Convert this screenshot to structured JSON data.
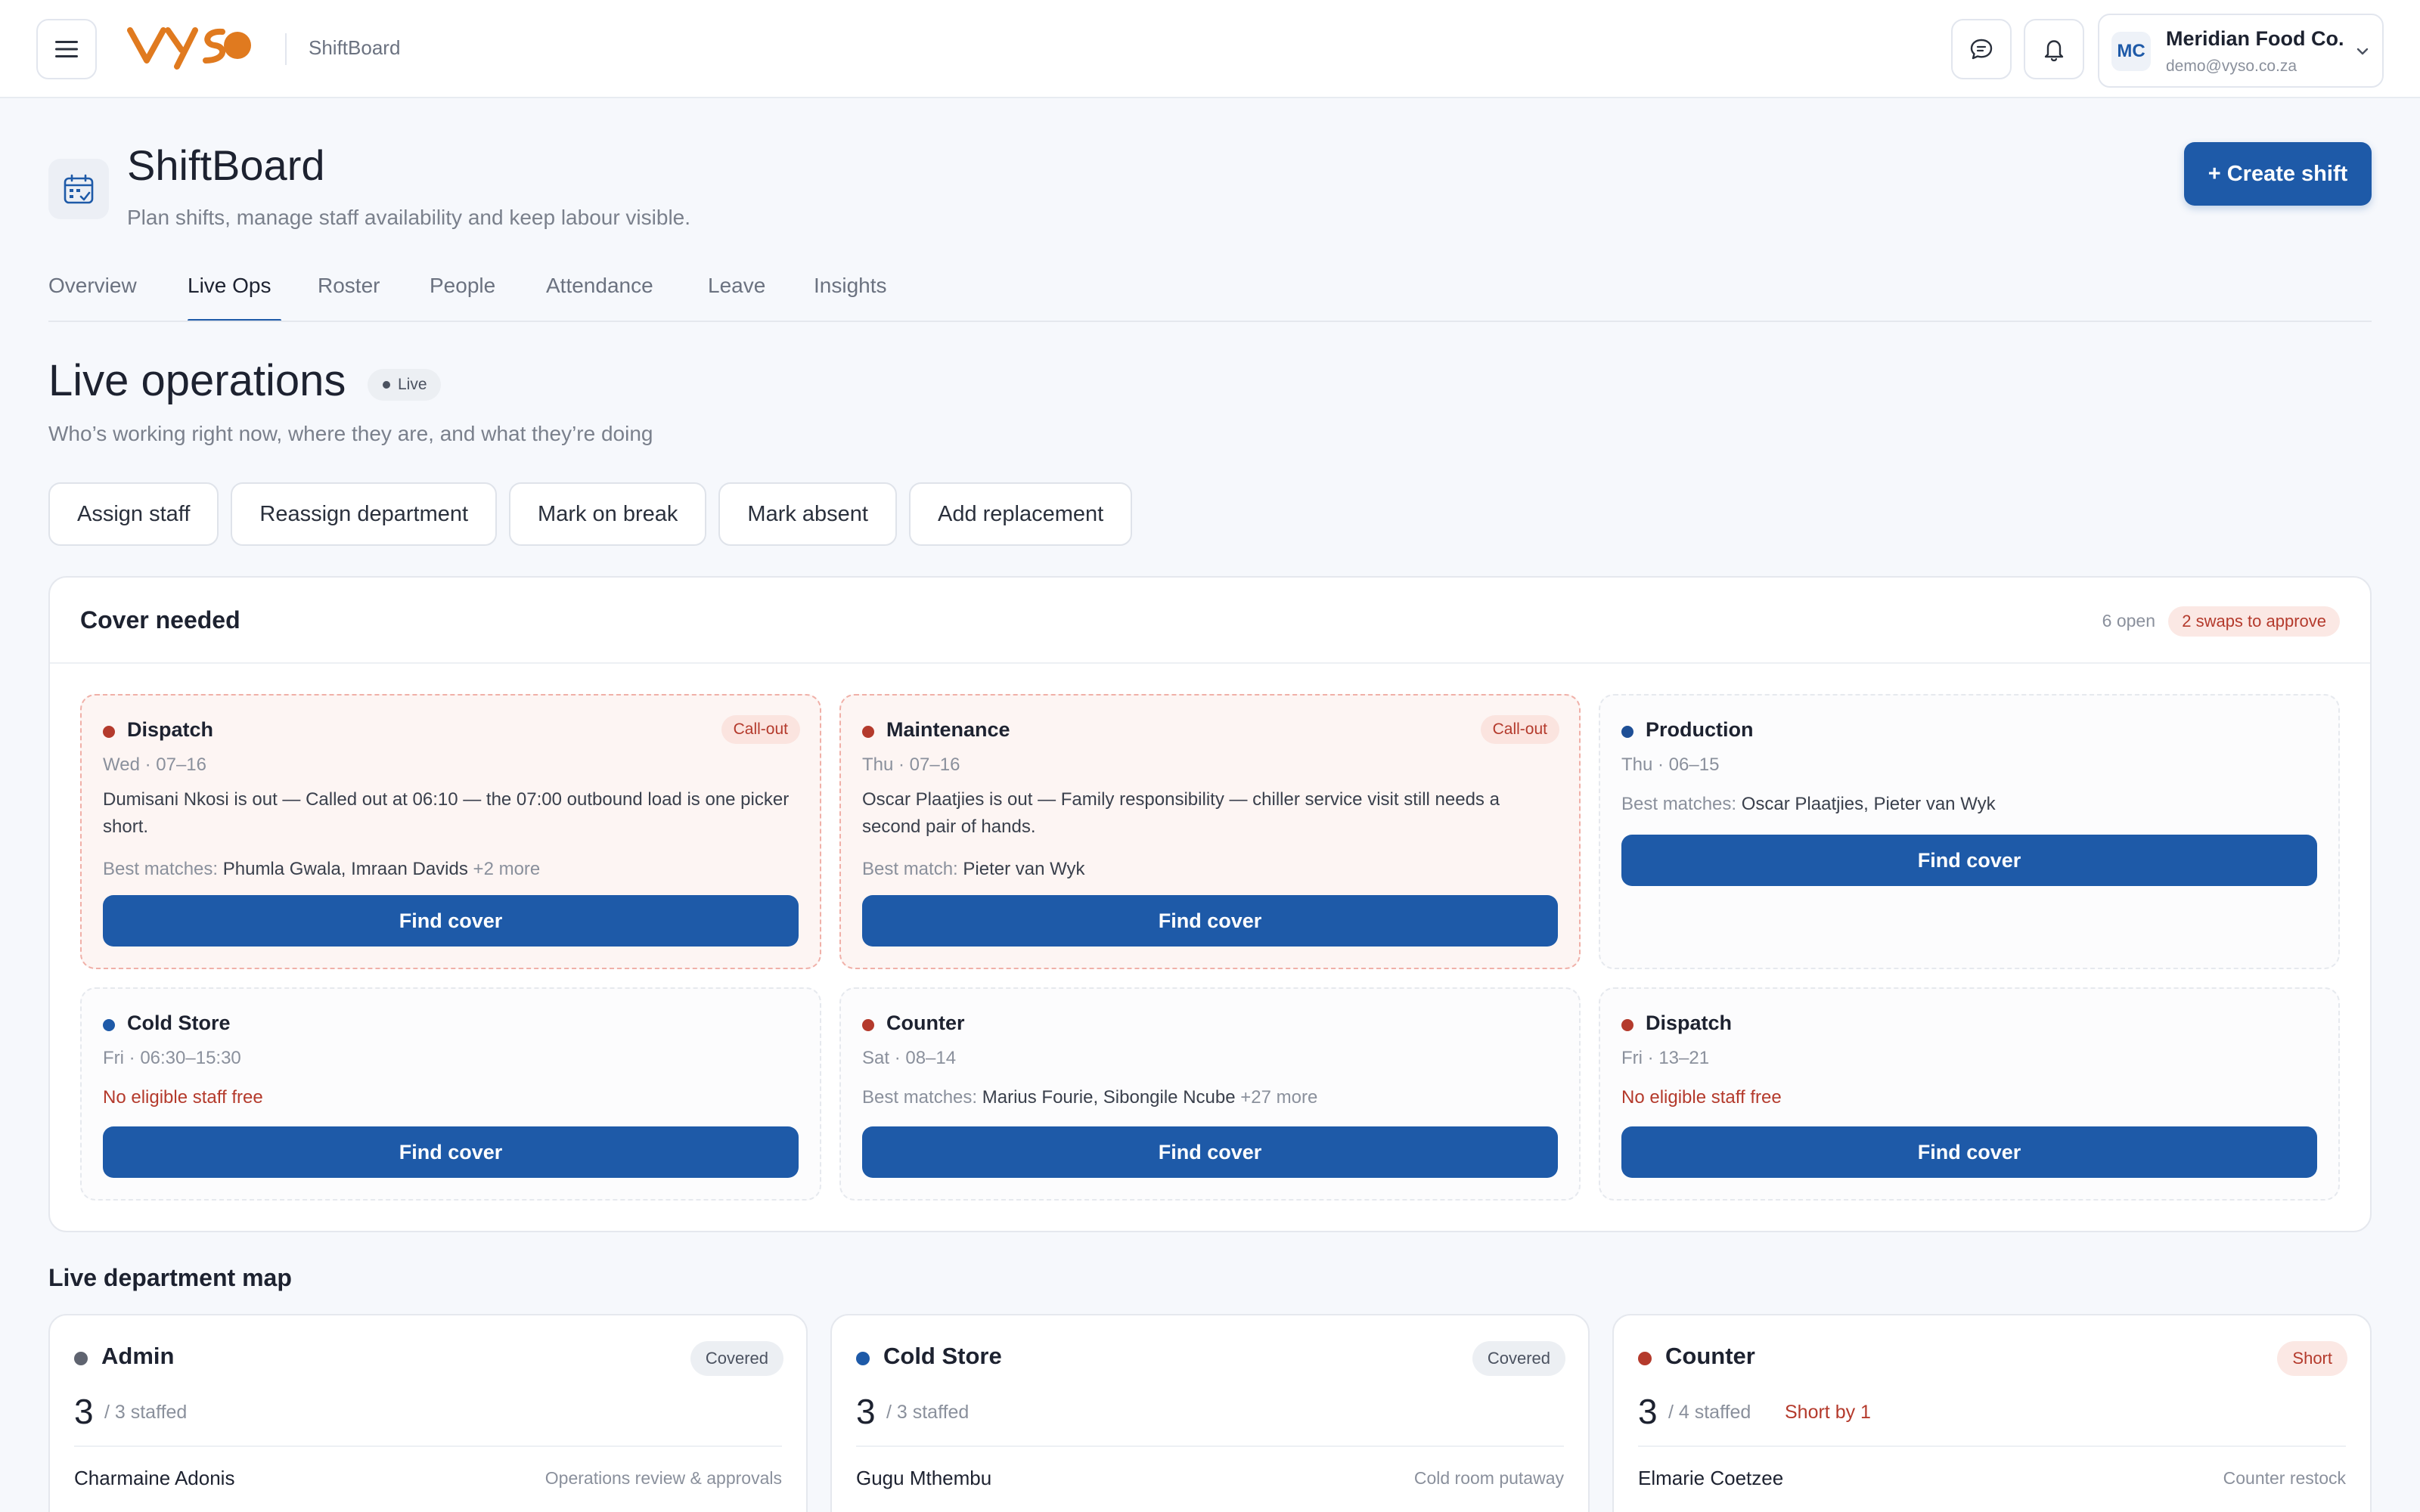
{
  "topbar": {
    "logo_text": "vyso",
    "app_name": "ShiftBoard",
    "account": {
      "initials": "MC",
      "name": "Meridian Food Co.",
      "email": "demo@vyso.co.za"
    }
  },
  "header": {
    "title": "ShiftBoard",
    "subtitle": "Plan shifts, manage staff availability and keep labour visible.",
    "create_label": "+ Create shift"
  },
  "tabs": [
    {
      "label": "Overview",
      "active": false
    },
    {
      "label": "Live Ops",
      "active": true
    },
    {
      "label": "Roster",
      "active": false
    },
    {
      "label": "People",
      "active": false
    },
    {
      "label": "Attendance",
      "active": false
    },
    {
      "label": "Leave",
      "active": false
    },
    {
      "label": "Insights",
      "active": false
    }
  ],
  "live": {
    "title": "Live operations",
    "badge": "Live",
    "subtitle": "Who’s working right now, where they are, and what they’re doing"
  },
  "actions": [
    "Assign staff",
    "Reassign department",
    "Mark on break",
    "Mark absent",
    "Add replacement"
  ],
  "cover": {
    "title": "Cover needed",
    "open_count": "6 open",
    "swaps": "2 swaps to approve",
    "find_label": "Find cover",
    "cards": [
      {
        "dept": "Dispatch",
        "tag": "Call-out",
        "when": "Wed · 07–16",
        "desc": "Dumisani Nkosi is out — Called out at 06:10 — the 07:00 outbound load is one picker short.",
        "match_label": "Best matches:",
        "matches": "Phumla Gwala, Imraan Davids",
        "more": "+2 more",
        "no_match": "",
        "color": "#b43a2c"
      },
      {
        "dept": "Maintenance",
        "tag": "Call-out",
        "when": "Thu · 07–16",
        "desc": "Oscar Plaatjies is out — Family responsibility — chiller service visit still needs a second pair of hands.",
        "match_label": "Best match:",
        "matches": "Pieter van Wyk",
        "more": "",
        "no_match": "",
        "color": "#b43a2c"
      },
      {
        "dept": "Production",
        "tag": "",
        "when": "Thu · 06–15",
        "desc": "",
        "match_label": "Best matches:",
        "matches": "Oscar Plaatjies, Pieter van Wyk",
        "more": "",
        "no_match": "",
        "color": "#1e4f96"
      },
      {
        "dept": "Cold Store",
        "tag": "",
        "when": "Fri · 06:30–15:30",
        "desc": "",
        "match_label": "",
        "matches": "",
        "more": "",
        "no_match": "No eligible staff free",
        "color": "#1e5aa8"
      },
      {
        "dept": "Counter",
        "tag": "",
        "when": "Sat · 08–14",
        "desc": "",
        "match_label": "Best matches:",
        "matches": "Marius Fourie, Sibongile Ncube",
        "more": "+27 more",
        "no_match": "",
        "color": "#b43a2c"
      },
      {
        "dept": "Dispatch",
        "tag": "",
        "when": "Fri · 13–21",
        "desc": "",
        "match_label": "",
        "matches": "",
        "more": "",
        "no_match": "No eligible staff free",
        "color": "#b43a2c"
      }
    ]
  },
  "map": {
    "title": "Live department map",
    "departments": [
      {
        "name": "Admin",
        "status": "Covered",
        "count": "3",
        "staffed": "/ 3 staffed",
        "short_by": "",
        "color": "#5f6470",
        "rows": [
          {
            "person": "Charmaine Adonis",
            "task": "Operations review & approvals"
          }
        ]
      },
      {
        "name": "Cold Store",
        "status": "Covered",
        "count": "3",
        "staffed": "/ 3 staffed",
        "short_by": "",
        "color": "#1e5aa8",
        "rows": [
          {
            "person": "Gugu Mthembu",
            "task": "Cold room putaway"
          }
        ]
      },
      {
        "name": "Counter",
        "status": "Short",
        "count": "3",
        "staffed": "/ 4 staffed",
        "short_by": "Short by 1",
        "color": "#b43a2c",
        "rows": [
          {
            "person": "Elmarie Coetzee",
            "task": "Counter restock"
          }
        ]
      }
    ]
  }
}
